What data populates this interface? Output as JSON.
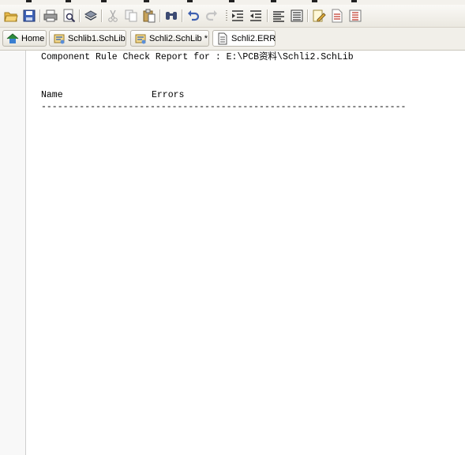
{
  "toolbar": {
    "icons": [
      "open-folder-icon",
      "save-icon",
      "print-icon",
      "print-preview-icon",
      "layers-icon",
      "cut-icon",
      "copy-icon",
      "paste-icon",
      "find-icon",
      "undo-icon",
      "redo-icon",
      "indent-icon",
      "outdent-icon",
      "align-icon",
      "list-icon",
      "edit-icon",
      "document-icon",
      "properties-icon"
    ]
  },
  "tabs": [
    {
      "label": "Home",
      "icon": "home-icon"
    },
    {
      "label": "Schlib1.SchLib",
      "icon": "schlib-icon"
    },
    {
      "label": "Schli2.SchLib *",
      "icon": "schlib-icon"
    },
    {
      "label": "Schli2.ERR",
      "icon": "document-icon",
      "active": true
    }
  ],
  "report": {
    "title_line": "Component Rule Check Report for : E:\\PCB资料\\Schli2.SchLib",
    "header_name": "Name",
    "header_errors": "Errors",
    "divider": "-------------------------------------------------------------------"
  },
  "colors": {
    "toolbar_bg": "#ebe8e0",
    "tab_border": "#b9b5ab",
    "text": "#000000"
  }
}
